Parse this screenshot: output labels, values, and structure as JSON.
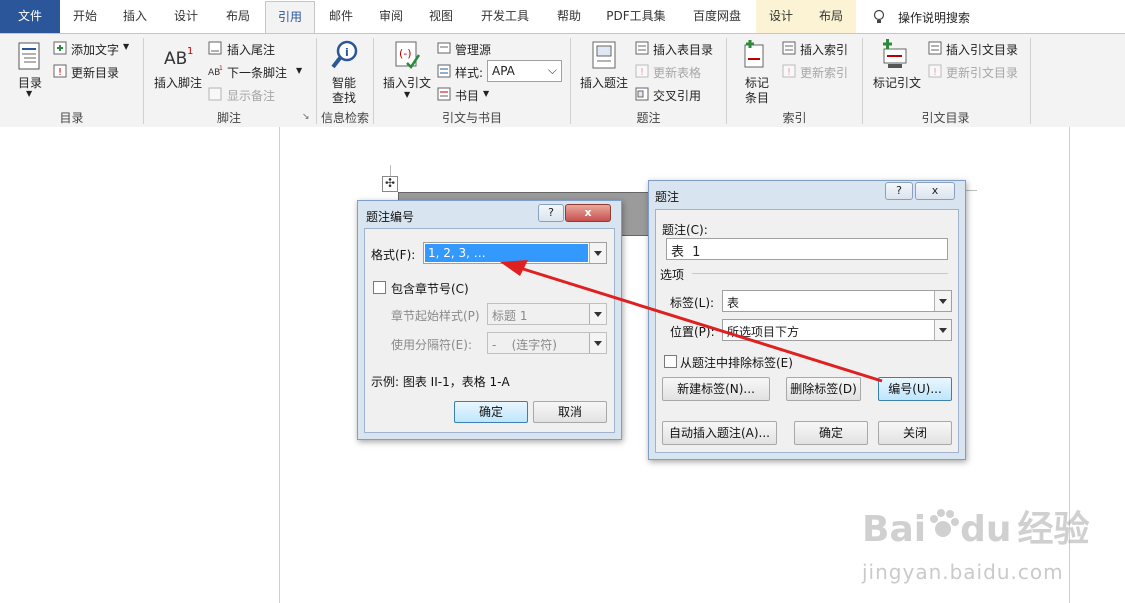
{
  "tabs": [
    {
      "label": "文件"
    },
    {
      "label": "开始"
    },
    {
      "label": "插入"
    },
    {
      "label": "设计"
    },
    {
      "label": "布局"
    },
    {
      "label": "引用"
    },
    {
      "label": "邮件"
    },
    {
      "label": "审阅"
    },
    {
      "label": "视图"
    },
    {
      "label": "开发工具"
    },
    {
      "label": "帮助"
    },
    {
      "label": "PDF工具集"
    },
    {
      "label": "百度网盘"
    },
    {
      "label": "设计"
    },
    {
      "label": "布局"
    }
  ],
  "tell_me": "操作说明搜索",
  "ribbon": {
    "toc": {
      "main": "目录",
      "add_text": "添加文字",
      "update_toc": "更新目录",
      "group": "目录"
    },
    "footnotes": {
      "insert_footnote": "插入脚注",
      "insert_endnote": "插入尾注",
      "next_footnote": "下一条脚注",
      "show_notes": "显示备注",
      "group": "脚注"
    },
    "research": {
      "smart_lookup_1": "智能",
      "smart_lookup_2": "查找",
      "group": "信息检索"
    },
    "citations": {
      "insert_citation": "插入引文",
      "manage_sources": "管理源",
      "style_label": "样式:",
      "style_value": "APA",
      "bibliography": "书目",
      "group": "引文与书目"
    },
    "captions": {
      "insert_caption": "插入题注",
      "insert_table_of_figures": "插入表目录",
      "update_table": "更新表格",
      "cross_reference": "交叉引用",
      "group": "题注"
    },
    "index": {
      "mark_entry_1": "标记",
      "mark_entry_2": "条目",
      "insert_index": "插入索引",
      "update_index": "更新索引",
      "group": "索引"
    },
    "authorities": {
      "mark_citation": "标记引文",
      "insert_toa": "插入引文目录",
      "update_toa": "更新引文目录",
      "group": "引文目录"
    }
  },
  "numbering_dialog": {
    "title": "题注编号",
    "help": "?",
    "close": "x",
    "format_label": "格式(F):",
    "format_value": "1, 2, 3, …",
    "include_chapter": "包含章节号(C)",
    "chapter_style_label": "章节起始样式(P)",
    "chapter_style_value": "标题 1",
    "separator_label": "使用分隔符(E):",
    "separator_value": "-    (连字符)",
    "example": "示例: 图表 II-1，表格 1-A",
    "ok": "确定",
    "cancel": "取消"
  },
  "caption_dialog": {
    "title": "题注",
    "help": "?",
    "close": "x",
    "caption_label": "题注(C):",
    "caption_value": "表 1",
    "options": "选项",
    "label_label": "标签(L):",
    "label_value": "表",
    "position_label": "位置(P):",
    "position_value": "所选项目下方",
    "exclude_label": "从题注中排除标签(E)",
    "new_label": "新建标签(N)...",
    "delete_label": "删除标签(D)",
    "numbering": "编号(U)...",
    "autocaption": "自动插入题注(A)...",
    "ok": "确定",
    "close_btn": "关闭"
  },
  "watermark": {
    "text1": "Bai",
    "text2": "du",
    "text3": "经验",
    "url": "jingyan.baidu.com"
  },
  "colors": {
    "file_tab": "#2b579a",
    "ribbon_bg": "#f3f3f3",
    "arrow": "#e02020"
  }
}
